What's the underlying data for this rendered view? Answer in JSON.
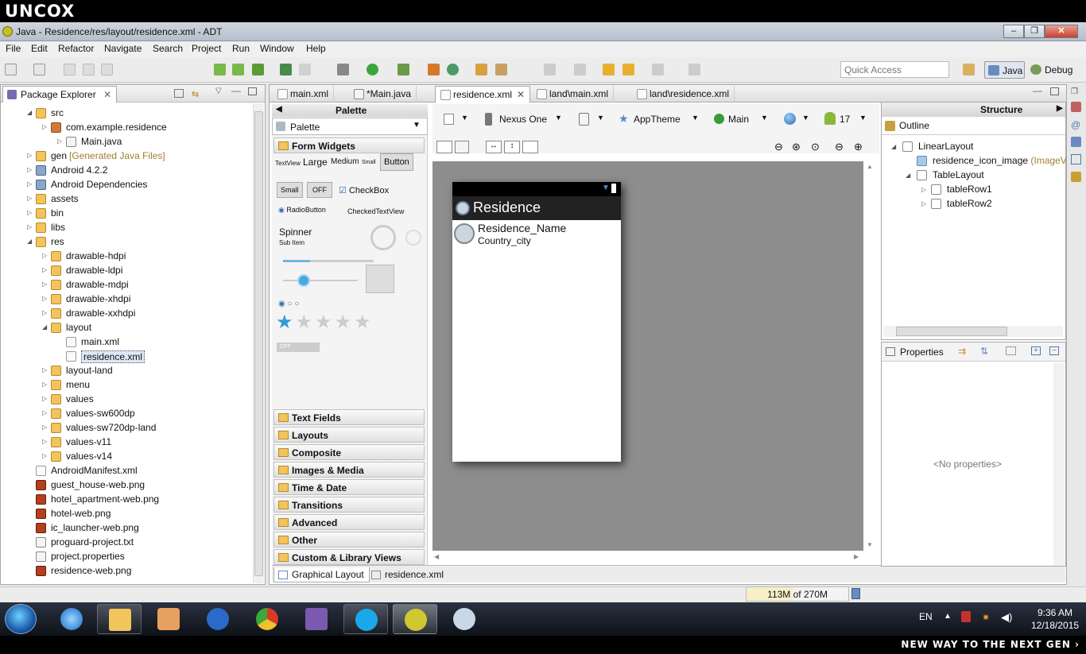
{
  "brand": {
    "logo": "UNCOX",
    "slogan": "NEW WAY TO THE NEXT GEN ›"
  },
  "window": {
    "title": "Java - Residence/res/layout/residence.xml - ADT",
    "min": "–",
    "max": "❐",
    "close": "✕"
  },
  "menu": [
    "File",
    "Edit",
    "Refactor",
    "Navigate",
    "Search",
    "Project",
    "Run",
    "Window",
    "Help"
  ],
  "quick_access": {
    "placeholder": "Quick Access"
  },
  "perspectives": {
    "java": "Java",
    "debug": "Debug"
  },
  "package_explorer": {
    "title": "Package Explorer",
    "items": [
      {
        "label": "src",
        "type": "folder",
        "depth": 1
      },
      {
        "label": "com.example.residence",
        "type": "pkg",
        "depth": 2
      },
      {
        "label": "Main.java",
        "type": "jfile",
        "depth": 3
      },
      {
        "label": "gen",
        "suffix": "[Generated Java Files]",
        "type": "folder",
        "depth": 1
      },
      {
        "label": "Android 4.2.2",
        "type": "lib",
        "depth": 1
      },
      {
        "label": "Android Dependencies",
        "type": "lib",
        "depth": 1
      },
      {
        "label": "assets",
        "type": "folder",
        "depth": 1
      },
      {
        "label": "bin",
        "type": "folder",
        "depth": 1
      },
      {
        "label": "libs",
        "type": "folder",
        "depth": 1
      },
      {
        "label": "res",
        "type": "folder",
        "depth": 1
      },
      {
        "label": "drawable-hdpi",
        "type": "folder",
        "depth": 2
      },
      {
        "label": "drawable-ldpi",
        "type": "folder",
        "depth": 2
      },
      {
        "label": "drawable-mdpi",
        "type": "folder",
        "depth": 2
      },
      {
        "label": "drawable-xhdpi",
        "type": "folder",
        "depth": 2
      },
      {
        "label": "drawable-xxhdpi",
        "type": "folder",
        "depth": 2
      },
      {
        "label": "layout",
        "type": "folder",
        "depth": 2
      },
      {
        "label": "main.xml",
        "type": "xml",
        "depth": 3
      },
      {
        "label": "residence.xml",
        "type": "xml",
        "depth": 3,
        "selected": true
      },
      {
        "label": "layout-land",
        "type": "folder",
        "depth": 2
      },
      {
        "label": "menu",
        "type": "folder",
        "depth": 2
      },
      {
        "label": "values",
        "type": "folder",
        "depth": 2
      },
      {
        "label": "values-sw600dp",
        "type": "folder",
        "depth": 2
      },
      {
        "label": "values-sw720dp-land",
        "type": "folder",
        "depth": 2
      },
      {
        "label": "values-v11",
        "type": "folder",
        "depth": 2
      },
      {
        "label": "values-v14",
        "type": "folder",
        "depth": 2
      },
      {
        "label": "AndroidManifest.xml",
        "type": "xml",
        "depth": 1
      },
      {
        "label": "guest_house-web.png",
        "type": "img",
        "depth": 1
      },
      {
        "label": "hotel_apartment-web.png",
        "type": "img",
        "depth": 1
      },
      {
        "label": "hotel-web.png",
        "type": "img",
        "depth": 1
      },
      {
        "label": "ic_launcher-web.png",
        "type": "img",
        "depth": 1
      },
      {
        "label": "proguard-project.txt",
        "type": "jfile",
        "depth": 1
      },
      {
        "label": "project.properties",
        "type": "jfile",
        "depth": 1
      },
      {
        "label": "residence-web.png",
        "type": "img",
        "depth": 1
      }
    ]
  },
  "editor_tabs": [
    "main.xml",
    "*Main.java",
    "residence.xml",
    "land\\main.xml",
    "land\\residence.xml"
  ],
  "palette": {
    "title": "Palette",
    "selector": "Palette",
    "section": "Form Widgets",
    "w_textview": "TextView",
    "w_large": "Large",
    "w_medium": "Medium",
    "w_small": "Small",
    "w_button": "Button",
    "w_smallbtn": "Small",
    "w_off": "OFF",
    "w_checkbox": "CheckBox",
    "w_radio": "RadioButton",
    "w_checked": "CheckedTextView",
    "w_spinner": "Spinner",
    "w_subitem": "Sub Item",
    "w_switch": "OFF",
    "categories": [
      "Text Fields",
      "Layouts",
      "Composite",
      "Images & Media",
      "Time & Date",
      "Transitions",
      "Advanced",
      "Other",
      "Custom & Library Views"
    ]
  },
  "canvas_toolbar": {
    "device": "Nexus One",
    "theme": "AppTheme",
    "activity": "Main",
    "api": "17"
  },
  "device_preview": {
    "app_title": "Residence",
    "name": "Residence_Name",
    "city": "Country_city"
  },
  "bottom_tabs": {
    "graphical": "Graphical Layout",
    "xml": "residence.xml"
  },
  "structure": {
    "title": "Structure",
    "outline": "Outline",
    "nodes": [
      {
        "label": "LinearLayout",
        "depth": 0
      },
      {
        "label": "residence_icon_image",
        "suffix": "(ImageVi",
        "depth": 1
      },
      {
        "label": "TableLayout",
        "depth": 1
      },
      {
        "label": "tableRow1",
        "depth": 2
      },
      {
        "label": "tableRow2",
        "depth": 2
      }
    ]
  },
  "properties": {
    "title": "Properties",
    "empty": "<No properties>"
  },
  "status": {
    "heap": "113M of 270M"
  },
  "taskbar": {
    "lang": "EN",
    "time": "9:36 AM",
    "date": "12/18/2015"
  },
  "colors": {
    "accent": "#2f6fb0",
    "selection": "#dce8f6",
    "canvas": "#8d8d8d"
  }
}
